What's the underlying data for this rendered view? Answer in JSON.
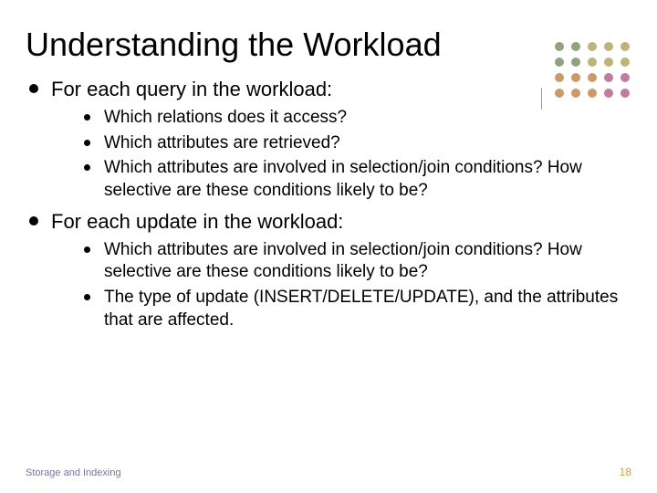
{
  "title": "Understanding the Workload",
  "deco": {
    "rows": [
      [
        "#8fa37e",
        "#8fa37e",
        "#bfb37a",
        "#bfb37a",
        "#bfb37a"
      ],
      [
        "#8fa37e",
        "#8fa37e",
        "#bfb37a",
        "#bfb37a",
        "#bfb37a"
      ],
      [
        "#cc9a66",
        "#cc9a66",
        "#cc9a66",
        "#c27ba0",
        "#c27ba0"
      ],
      [
        "#cc9a66",
        "#cc9a66",
        "#cc9a66",
        "#c27ba0",
        "#c27ba0"
      ]
    ]
  },
  "bullets": [
    {
      "text": "For each query in the workload:",
      "children": [
        "Which relations does it access?",
        "Which attributes are retrieved?",
        "Which attributes are involved in selection/join conditions?  How selective are these conditions likely to be?"
      ]
    },
    {
      "text": "For each update in the workload:",
      "children": [
        "Which attributes are involved in selection/join conditions?  How selective are these conditions likely to be?",
        "The type of update (INSERT/DELETE/UPDATE), and the attributes that are affected."
      ]
    }
  ],
  "footer": {
    "left": "Storage and Indexing",
    "right": "18"
  }
}
